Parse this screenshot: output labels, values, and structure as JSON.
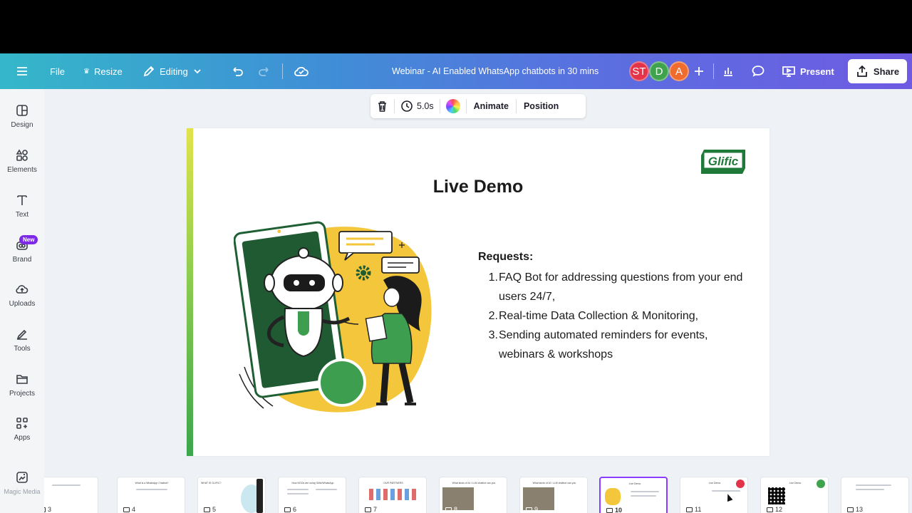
{
  "header": {
    "file_label": "File",
    "resize_label": "Resize",
    "editing_label": "Editing",
    "doc_title": "Webinar - AI Enabled WhatsApp chatbots in 30 mins",
    "avatars": [
      {
        "initials": "ST",
        "color": "#e4344a"
      },
      {
        "initials": "D",
        "color": "#3fa34d"
      },
      {
        "initials": "A",
        "color": "#ef6c2e"
      }
    ],
    "present_label": "Present",
    "share_label": "Share"
  },
  "sidebar": {
    "items": [
      {
        "label": "Design",
        "icon": "design-icon"
      },
      {
        "label": "Elements",
        "icon": "elements-icon"
      },
      {
        "label": "Text",
        "icon": "text-icon"
      },
      {
        "label": "Brand",
        "icon": "brand-icon",
        "badge": "New"
      },
      {
        "label": "Uploads",
        "icon": "uploads-icon"
      },
      {
        "label": "Tools",
        "icon": "tools-icon"
      },
      {
        "label": "Projects",
        "icon": "projects-icon"
      },
      {
        "label": "Apps",
        "icon": "apps-icon"
      },
      {
        "label": "Magic Media",
        "icon": "magic-media-icon"
      }
    ]
  },
  "toolbar": {
    "duration": "5.0s",
    "animate_label": "Animate",
    "position_label": "Position"
  },
  "slide": {
    "title": "Live Demo",
    "logo_text": "Glific",
    "requests_title": "Requests:",
    "requests": [
      {
        "num": "1.",
        "text": "FAQ Bot for addressing questions from your end users 24/7,"
      },
      {
        "num": "2.",
        "text": "Real-time Data Collection & Monitoring,"
      },
      {
        "num": "3.",
        "text": "Sending automated reminders for events, webinars & workshops"
      }
    ]
  },
  "filmstrip": {
    "pages": [
      {
        "num": "3",
        "title": ""
      },
      {
        "num": "4",
        "title": "What is a WhatsApp Chatbot?"
      },
      {
        "num": "5",
        "title": "WHAT IS GLIFIC?"
      },
      {
        "num": "6",
        "title": "How NGOs are using Glific/WhatsApp"
      },
      {
        "num": "7",
        "title": "OUR PARTNERS"
      },
      {
        "num": "8",
        "title": "What kinds of AI / LLM chatbot can you"
      },
      {
        "num": "9",
        "title": "What kinds of AI / LLM chatbot can you"
      },
      {
        "num": "10",
        "title": "Live Demo",
        "active": true
      },
      {
        "num": "11",
        "title": "Live Demo"
      },
      {
        "num": "12",
        "title": "Live Demo"
      },
      {
        "num": "13",
        "title": ""
      }
    ]
  }
}
